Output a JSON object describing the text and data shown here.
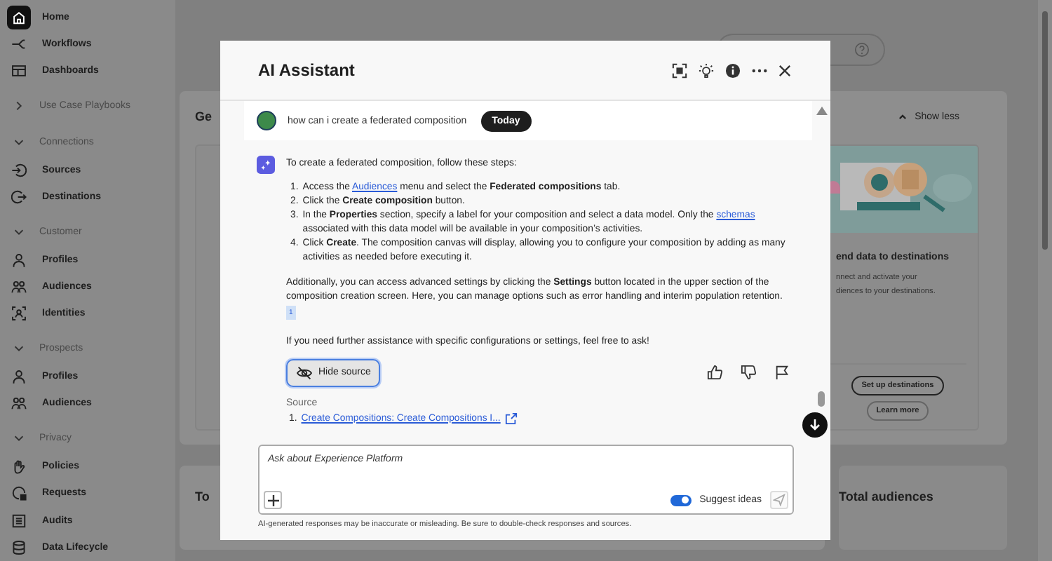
{
  "sidebar": {
    "items": [
      {
        "kind": "link",
        "label": "Home",
        "selected": true
      },
      {
        "kind": "link",
        "label": "Workflows",
        "selected": false
      },
      {
        "kind": "link",
        "label": "Dashboards",
        "selected": false
      },
      {
        "kind": "section",
        "label": "Use Case Playbooks",
        "expanded": false
      },
      {
        "kind": "section",
        "label": "Connections",
        "expanded": true
      },
      {
        "kind": "link",
        "label": "Sources",
        "selected": false
      },
      {
        "kind": "link",
        "label": "Destinations",
        "selected": false
      },
      {
        "kind": "section",
        "label": "Customer",
        "expanded": true
      },
      {
        "kind": "link",
        "label": "Profiles",
        "selected": false
      },
      {
        "kind": "link",
        "label": "Audiences",
        "selected": false
      },
      {
        "kind": "link",
        "label": "Identities",
        "selected": false
      },
      {
        "kind": "section",
        "label": "Prospects",
        "expanded": true
      },
      {
        "kind": "link",
        "label": "Profiles",
        "selected": false
      },
      {
        "kind": "link",
        "label": "Audiences",
        "selected": false
      },
      {
        "kind": "section",
        "label": "Privacy",
        "expanded": true
      },
      {
        "kind": "link",
        "label": "Policies",
        "selected": false
      },
      {
        "kind": "link",
        "label": "Requests",
        "selected": false
      },
      {
        "kind": "link",
        "label": "Audits",
        "selected": false
      },
      {
        "kind": "link",
        "label": "Data Lifecycle",
        "selected": false
      }
    ]
  },
  "overview_card": {
    "title": "Ge",
    "toggle": "Show less",
    "destination_card": {
      "title": "end data to destinations",
      "description_lines": [
        "nnect and activate your",
        "diences to your destinations."
      ],
      "buttons": [
        "Set up destinations",
        "Learn more"
      ]
    }
  },
  "stat_cards": [
    {
      "title": "To"
    },
    {
      "title": "Total audiences"
    }
  ],
  "assistant": {
    "title": "AI Assistant",
    "user_message": "how can i create a federated composition",
    "date_badge": "Today",
    "intro": "To create a federated composition, follow these steps:",
    "steps": [
      {
        "number": "1.",
        "segments": [
          {
            "kind": "text",
            "text": "Access the "
          },
          {
            "kind": "link",
            "text": "Audiences"
          },
          {
            "kind": "text",
            "text": " menu and select the **Federated compositions** tab."
          }
        ]
      },
      {
        "number": "2.",
        "segments": [
          {
            "kind": "text",
            "text": "Click the **Create composition** button."
          }
        ]
      },
      {
        "number": "3.",
        "segments": [
          {
            "kind": "text",
            "text": "In the **Properties** section, specify a label for your composition and select a data model. Only the "
          },
          {
            "kind": "link",
            "text": "schemas"
          },
          {
            "kind": "text",
            "text": " associated with this data model will be available in your composition’s activities."
          }
        ]
      },
      {
        "number": "4.",
        "segments": [
          {
            "kind": "text",
            "text": "Click **Create**. The composition canvas will display, allowing you to configure your composition by adding as many activities as needed before executing it."
          }
        ]
      }
    ],
    "paragraph": "Additionally, you can access advanced settings by clicking the **Settings** button located in the upper section of the composition creation screen. Here, you can manage options such as error handling and interim population retention.",
    "citation": "1",
    "closing": "If you need further assistance with specific configurations or settings, feel free to ask!",
    "hide_source_button": "Hide source",
    "source_label": "Source",
    "sources": [
      {
        "number": "1.",
        "title": "Create Compositions: Create Compositions I..."
      }
    ],
    "input": {
      "placeholder": "Ask about Experience Platform"
    },
    "suggest_ideas": {
      "label": "Suggest ideas",
      "on": true
    },
    "disclaimer": "AI-generated responses may be inaccurate or misleading. Be sure to double-check responses and sources."
  }
}
